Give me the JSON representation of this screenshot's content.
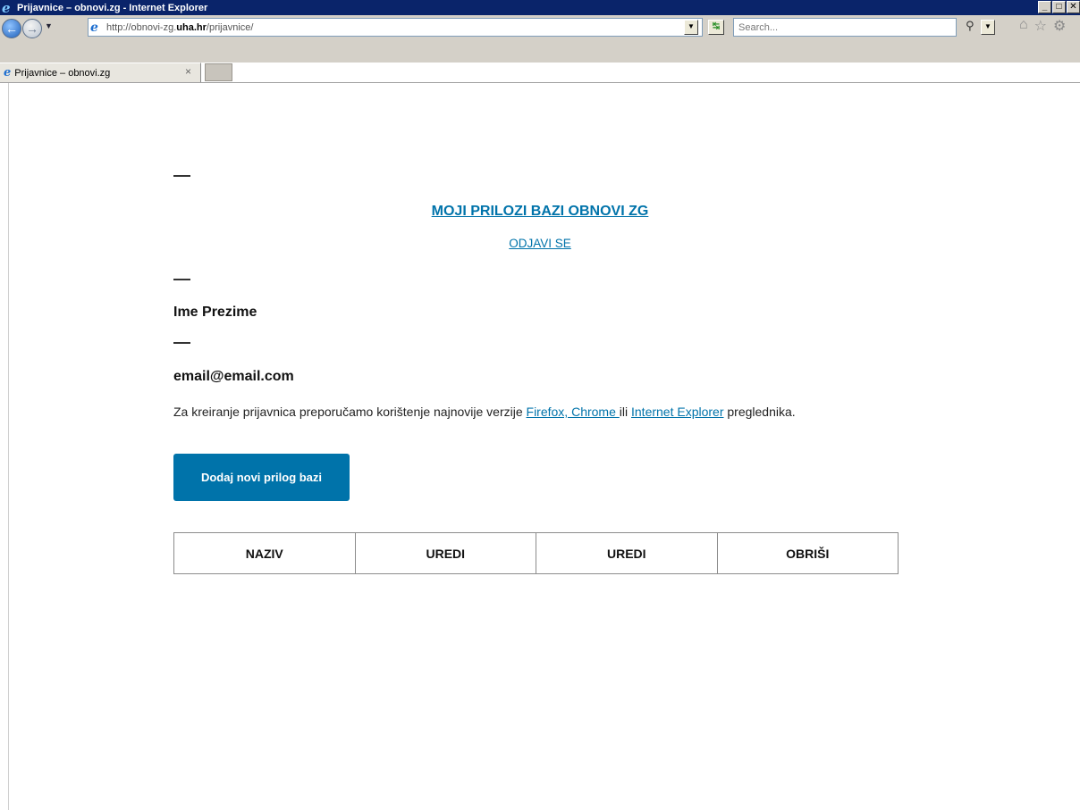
{
  "window": {
    "title": "Prijavnice – obnovi.zg - Internet Explorer",
    "minimize": "_",
    "maximize": "□",
    "close": "✕"
  },
  "navbar": {
    "address_prefix": "http://obnovi-zg.",
    "address_domain": "uha.hr",
    "address_path": "/prijavnice/",
    "search_placeholder": "Search...",
    "icons": [
      "back-icon",
      "forward-icon",
      "ie-page-icon",
      "compat-view-icon",
      "search-icon",
      "home-icon",
      "favorites-star-icon",
      "settings-gear-icon"
    ]
  },
  "tab": {
    "label": "Prijavnice – obnovi.zg",
    "close": "×"
  },
  "page": {
    "title": "MOJI PRILOZI BAZI OBNOVI ZG",
    "logout": "ODJAVI SE",
    "user_name": "Ime Prezime",
    "user_email": "email@email.com",
    "info": {
      "before": "Za kreiranje prijavnica preporučamo korištenje najnovije verzije ",
      "link1": "Firefox, Chrome ",
      "middle": "ili ",
      "link2": "Internet Explorer",
      "after": " preglednika."
    },
    "add_button": "Dodaj novi prilog bazi",
    "table_headers": [
      "NAZIV",
      "UREDI",
      "UREDI",
      "OBRIŠI"
    ]
  },
  "colors": {
    "link": "#0073aa",
    "button_bg": "#0073aa",
    "titlebar": "#0a246a",
    "chrome": "#d4d0c8"
  }
}
